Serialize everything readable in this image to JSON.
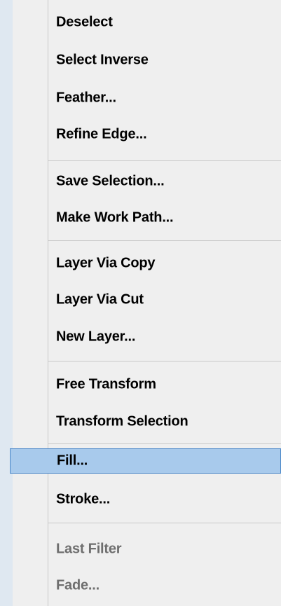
{
  "menu": {
    "items": [
      {
        "label": "Deselect"
      },
      {
        "label": "Select Inverse"
      },
      {
        "label": "Feather..."
      },
      {
        "label": "Refine Edge..."
      },
      {
        "label": "Save Selection..."
      },
      {
        "label": "Make Work Path..."
      },
      {
        "label": "Layer Via Copy"
      },
      {
        "label": "Layer Via Cut"
      },
      {
        "label": "New Layer..."
      },
      {
        "label": "Free Transform"
      },
      {
        "label": "Transform Selection"
      },
      {
        "label": "Fill..."
      },
      {
        "label": "Stroke..."
      },
      {
        "label": "Last Filter"
      },
      {
        "label": "Fade..."
      }
    ],
    "selected_item": "Fill...",
    "disabled_items": [
      "Last Filter",
      "Fade..."
    ]
  },
  "colors": {
    "background": "#dfe8f1",
    "menu_background": "#efefef",
    "highlight_fill": "#a8caec",
    "highlight_border": "#4b88c9",
    "disabled_text": "#6e6e6e"
  }
}
